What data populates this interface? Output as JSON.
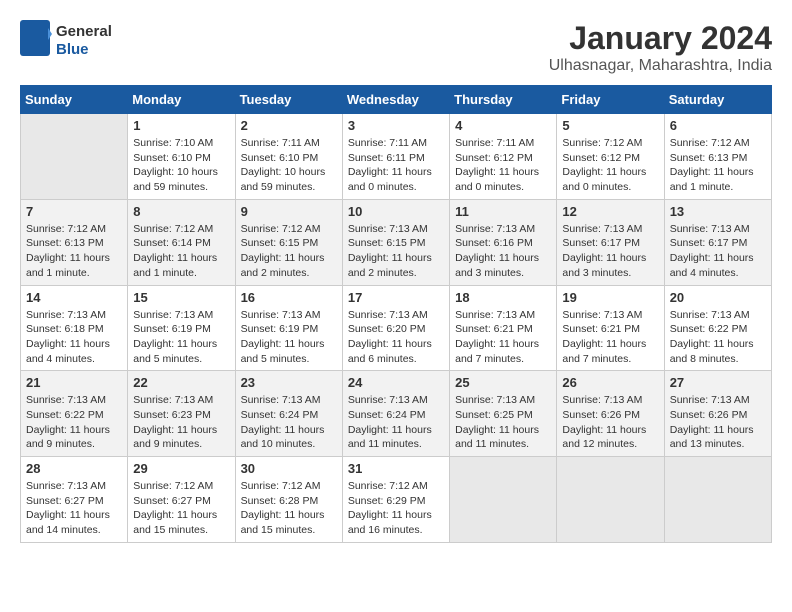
{
  "header": {
    "logo_line1": "General",
    "logo_line2": "Blue",
    "month": "January 2024",
    "location": "Ulhasnagar, Maharashtra, India"
  },
  "weekdays": [
    "Sunday",
    "Monday",
    "Tuesday",
    "Wednesday",
    "Thursday",
    "Friday",
    "Saturday"
  ],
  "weeks": [
    [
      {
        "day": "",
        "info": ""
      },
      {
        "day": "1",
        "info": "Sunrise: 7:10 AM\nSunset: 6:10 PM\nDaylight: 10 hours\nand 59 minutes."
      },
      {
        "day": "2",
        "info": "Sunrise: 7:11 AM\nSunset: 6:10 PM\nDaylight: 10 hours\nand 59 minutes."
      },
      {
        "day": "3",
        "info": "Sunrise: 7:11 AM\nSunset: 6:11 PM\nDaylight: 11 hours\nand 0 minutes."
      },
      {
        "day": "4",
        "info": "Sunrise: 7:11 AM\nSunset: 6:12 PM\nDaylight: 11 hours\nand 0 minutes."
      },
      {
        "day": "5",
        "info": "Sunrise: 7:12 AM\nSunset: 6:12 PM\nDaylight: 11 hours\nand 0 minutes."
      },
      {
        "day": "6",
        "info": "Sunrise: 7:12 AM\nSunset: 6:13 PM\nDaylight: 11 hours\nand 1 minute."
      }
    ],
    [
      {
        "day": "7",
        "info": "Sunrise: 7:12 AM\nSunset: 6:13 PM\nDaylight: 11 hours\nand 1 minute."
      },
      {
        "day": "8",
        "info": "Sunrise: 7:12 AM\nSunset: 6:14 PM\nDaylight: 11 hours\nand 1 minute."
      },
      {
        "day": "9",
        "info": "Sunrise: 7:12 AM\nSunset: 6:15 PM\nDaylight: 11 hours\nand 2 minutes."
      },
      {
        "day": "10",
        "info": "Sunrise: 7:13 AM\nSunset: 6:15 PM\nDaylight: 11 hours\nand 2 minutes."
      },
      {
        "day": "11",
        "info": "Sunrise: 7:13 AM\nSunset: 6:16 PM\nDaylight: 11 hours\nand 3 minutes."
      },
      {
        "day": "12",
        "info": "Sunrise: 7:13 AM\nSunset: 6:17 PM\nDaylight: 11 hours\nand 3 minutes."
      },
      {
        "day": "13",
        "info": "Sunrise: 7:13 AM\nSunset: 6:17 PM\nDaylight: 11 hours\nand 4 minutes."
      }
    ],
    [
      {
        "day": "14",
        "info": "Sunrise: 7:13 AM\nSunset: 6:18 PM\nDaylight: 11 hours\nand 4 minutes."
      },
      {
        "day": "15",
        "info": "Sunrise: 7:13 AM\nSunset: 6:19 PM\nDaylight: 11 hours\nand 5 minutes."
      },
      {
        "day": "16",
        "info": "Sunrise: 7:13 AM\nSunset: 6:19 PM\nDaylight: 11 hours\nand 5 minutes."
      },
      {
        "day": "17",
        "info": "Sunrise: 7:13 AM\nSunset: 6:20 PM\nDaylight: 11 hours\nand 6 minutes."
      },
      {
        "day": "18",
        "info": "Sunrise: 7:13 AM\nSunset: 6:21 PM\nDaylight: 11 hours\nand 7 minutes."
      },
      {
        "day": "19",
        "info": "Sunrise: 7:13 AM\nSunset: 6:21 PM\nDaylight: 11 hours\nand 7 minutes."
      },
      {
        "day": "20",
        "info": "Sunrise: 7:13 AM\nSunset: 6:22 PM\nDaylight: 11 hours\nand 8 minutes."
      }
    ],
    [
      {
        "day": "21",
        "info": "Sunrise: 7:13 AM\nSunset: 6:22 PM\nDaylight: 11 hours\nand 9 minutes."
      },
      {
        "day": "22",
        "info": "Sunrise: 7:13 AM\nSunset: 6:23 PM\nDaylight: 11 hours\nand 9 minutes."
      },
      {
        "day": "23",
        "info": "Sunrise: 7:13 AM\nSunset: 6:24 PM\nDaylight: 11 hours\nand 10 minutes."
      },
      {
        "day": "24",
        "info": "Sunrise: 7:13 AM\nSunset: 6:24 PM\nDaylight: 11 hours\nand 11 minutes."
      },
      {
        "day": "25",
        "info": "Sunrise: 7:13 AM\nSunset: 6:25 PM\nDaylight: 11 hours\nand 11 minutes."
      },
      {
        "day": "26",
        "info": "Sunrise: 7:13 AM\nSunset: 6:26 PM\nDaylight: 11 hours\nand 12 minutes."
      },
      {
        "day": "27",
        "info": "Sunrise: 7:13 AM\nSunset: 6:26 PM\nDaylight: 11 hours\nand 13 minutes."
      }
    ],
    [
      {
        "day": "28",
        "info": "Sunrise: 7:13 AM\nSunset: 6:27 PM\nDaylight: 11 hours\nand 14 minutes."
      },
      {
        "day": "29",
        "info": "Sunrise: 7:12 AM\nSunset: 6:27 PM\nDaylight: 11 hours\nand 15 minutes."
      },
      {
        "day": "30",
        "info": "Sunrise: 7:12 AM\nSunset: 6:28 PM\nDaylight: 11 hours\nand 15 minutes."
      },
      {
        "day": "31",
        "info": "Sunrise: 7:12 AM\nSunset: 6:29 PM\nDaylight: 11 hours\nand 16 minutes."
      },
      {
        "day": "",
        "info": ""
      },
      {
        "day": "",
        "info": ""
      },
      {
        "day": "",
        "info": ""
      }
    ]
  ]
}
